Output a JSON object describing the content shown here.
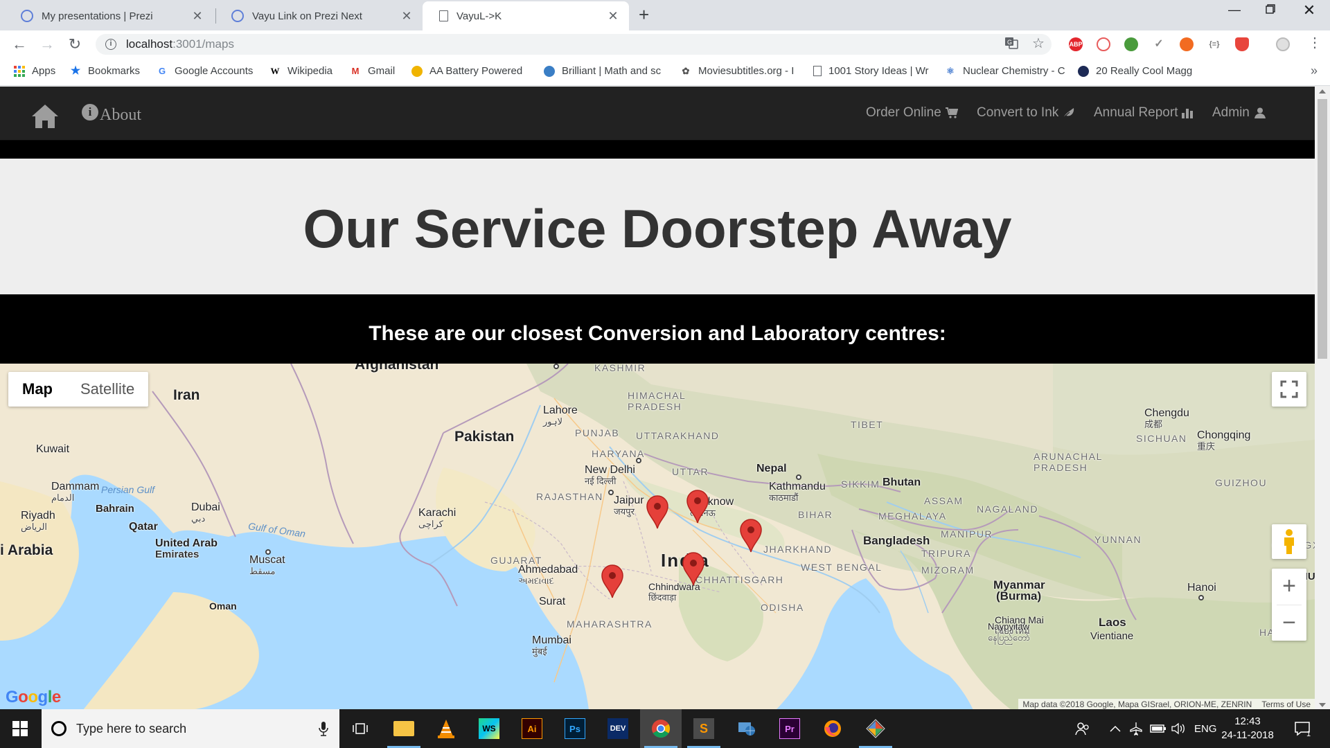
{
  "browser": {
    "tabs": [
      {
        "title": "My presentations | Prezi",
        "icon": "prezi-icon"
      },
      {
        "title": "Vayu Link on Prezi Next",
        "icon": "prezi-icon"
      },
      {
        "title": "VayuL->K",
        "icon": "page-icon",
        "active": true
      }
    ],
    "url_host": "localhost",
    "url_path": ":3001/maps",
    "bookmarks": [
      {
        "label": "Apps",
        "icon": "apps-grid-icon"
      },
      {
        "label": "Bookmarks",
        "icon": "star-icon"
      },
      {
        "label": "Google Accounts",
        "icon": "google-g-icon"
      },
      {
        "label": "Wikipedia",
        "icon": "wikipedia-w-icon"
      },
      {
        "label": "Gmail",
        "icon": "gmail-icon"
      },
      {
        "label": "AA Battery Powered",
        "icon": "bookmark-favicon"
      },
      {
        "label": "Brilliant | Math and sc",
        "icon": "bookmark-favicon"
      },
      {
        "label": "Moviesubtitles.org - I",
        "icon": "bookmark-favicon"
      },
      {
        "label": "1001 Story Ideas | Wr",
        "icon": "page-icon"
      },
      {
        "label": "Nuclear Chemistry - C",
        "icon": "bookmark-favicon"
      },
      {
        "label": "20 Really Cool Magg",
        "icon": "bookmark-favicon"
      }
    ]
  },
  "nav": {
    "about": "About",
    "items": [
      {
        "label": "Order Online",
        "icon": "cart-icon"
      },
      {
        "label": "Convert to Ink",
        "icon": "leaf-icon"
      },
      {
        "label": "Annual Report",
        "icon": "bar-chart-icon"
      },
      {
        "label": "Admin",
        "icon": "user-icon"
      }
    ]
  },
  "hero": {
    "title": "Our Service Doorstep Away"
  },
  "section": {
    "subtitle": "These are our closest Conversion and Laboratory centres:"
  },
  "map": {
    "map_type_options": [
      "Map",
      "Satellite"
    ],
    "selected_map_type": "Map",
    "labels": {
      "afghanistan": "Afghanistan",
      "kashmir": "KASHMIR",
      "iran": "Iran",
      "lahore": "Lahore",
      "lahore_local": "لاہور",
      "himachal": "HIMACHAL",
      "pradesh": "PRADESH",
      "tibet": "TIBET",
      "chengdu": "Chengdu",
      "chengdu_local": "成都",
      "sichuan": "SICHUAN",
      "chongqing": "Chongqing",
      "chongqing_local": "重庆",
      "pakistan": "Pakistan",
      "punjab": "PUNJAB",
      "uttarakhand": "UTTARAKHAND",
      "kuwait": "Kuwait",
      "haryana": "HARYANA",
      "new_delhi": "New Delhi",
      "new_delhi_local": "नई दिल्ली",
      "uttar": "UTTAR",
      "nepal": "Nepal",
      "arunachal": "ARUNACHAL",
      "arunachal2": "PRADESH",
      "guizhou": "GUIZHOU",
      "dammam": "Dammam",
      "dammam_local": "الدمام",
      "persian_gulf": "Persian Gulf",
      "rajasthan": "RAJASTHAN",
      "jaipur": "Jaipur",
      "jaipur_local": "जयपुर",
      "lucknow": "Lucknow",
      "lucknow_local": "लखनऊ",
      "kathmandu": "Kathmandu",
      "kathmandu_local": "काठमाडौं",
      "sikkim": "SIKKIM",
      "bhutan": "Bhutan",
      "bahrain": "Bahrain",
      "dubai": "Dubai",
      "dubai_local": "دبي",
      "assam": "ASSAM",
      "nagaland": "NAGALAND",
      "riyadh": "Riyadh",
      "riyadh_local": "الرياض",
      "karachi": "Karachi",
      "karachi_local": "کراچی",
      "bihar": "BIHAR",
      "meghalaya": "MEGHALAYA",
      "qatar": "Qatar",
      "gulf_of_oman": "Gulf of Oman",
      "manipur": "MANIPUR",
      "yunnan": "YUNNAN",
      "uae": "United Arab",
      "uae2": "Emirates",
      "jharkhand": "JHARKHAND",
      "bangladesh": "Bangladesh",
      "guangxi": "GUANGXI",
      "saudi": "i Arabia",
      "muscat": "Muscat",
      "muscat_local": "مسقط",
      "gujarat": "GUJARAT",
      "tripura": "TRIPURA",
      "ahmedabad": "Ahmedabad",
      "ahmedabad_local": "અમદાવાદ",
      "india": "India",
      "west_bengal": "WEST BENGAL",
      "mizoram": "MIZORAM",
      "chhattisgarh": "CHHATTISGARH",
      "chhindwara": "Chhindwara",
      "chhindwara_local": "छिंदवाड़ा",
      "myanmar": "Myanmar",
      "burma": "(Burma)",
      "hanoi": "Hanoi",
      "oman": "Oman",
      "surat": "Surat",
      "odisha": "ODISHA",
      "maharashtra": "MAHARASHTRA",
      "chiang_mai": "Chiang Mai",
      "chiang_mai_local": "เชียงใหม่",
      "laos": "Laos",
      "naypyitaw": "Naypyitaw",
      "naypyitaw_local": "နေပြည်တော်",
      "mumbai": "Mumbai",
      "mumbai_local": "मुंबई",
      "vientiane": "Vientiane",
      "hainan": "HAINAN",
      "hu": "HU"
    },
    "google_logo": "Google",
    "attribution": "Map data ©2018 Google, Mapa GISrael, ORION-ME, ZENRIN",
    "terms": "Terms of Use",
    "marker_count": 5,
    "marker_color": "#e5403a"
  },
  "taskbar": {
    "search_placeholder": "Type here to search",
    "apps": [
      "task-view",
      "file-explorer",
      "vlc",
      "webstorm",
      "illustrator",
      "photoshop",
      "dev",
      "chrome",
      "sublime-text",
      "network",
      "premiere",
      "firefox",
      "git"
    ],
    "language": "ENG",
    "time": "12:43",
    "date": "24-11-2018",
    "notification_count": "1"
  }
}
